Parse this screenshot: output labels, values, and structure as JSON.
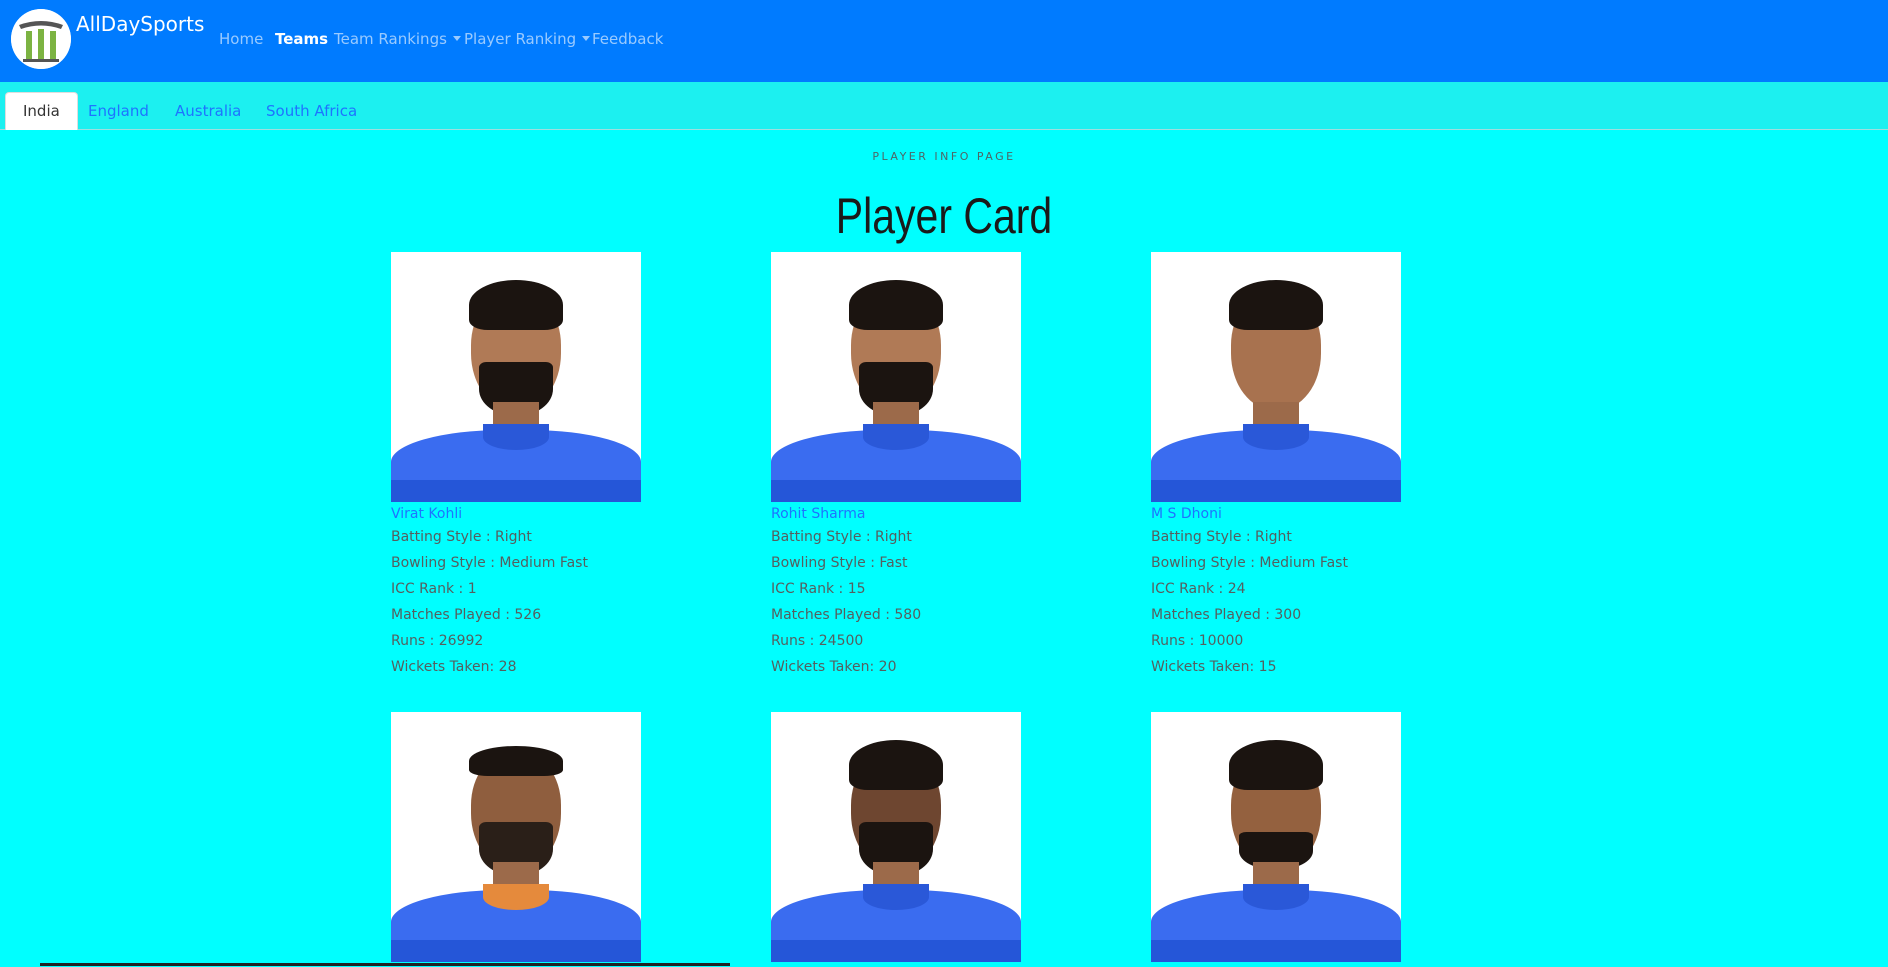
{
  "navbar": {
    "brand": "AllDaySports",
    "links": [
      {
        "label": "Home"
      },
      {
        "label": "Teams",
        "active": true
      },
      {
        "label": "Team Rankings",
        "dropdown": true
      },
      {
        "label": "Player Ranking",
        "dropdown": true
      },
      {
        "label": "Feedback"
      }
    ]
  },
  "tabs": [
    {
      "label": "India",
      "active": true
    },
    {
      "label": "England"
    },
    {
      "label": "Australia"
    },
    {
      "label": "South Africa"
    }
  ],
  "eyebrow": "PLAYER INFO PAGE",
  "title": "Player Card",
  "labels": {
    "batting": "Batting Style : ",
    "bowling": "Bowling Style : ",
    "rank": "ICC Rank : ",
    "matches": "Matches Played : ",
    "runs": "Runs : ",
    "wickets": "Wickets Taken: "
  },
  "players": [
    {
      "name": "Virat Kohli",
      "batting": "Right",
      "bowling": "Medium Fast",
      "rank": "1",
      "matches": "526",
      "runs": "26992",
      "wickets": "28"
    },
    {
      "name": "Rohit Sharma",
      "batting": "Right",
      "bowling": "Fast",
      "rank": "15",
      "matches": "580",
      "runs": "24500",
      "wickets": "20"
    },
    {
      "name": "M S Dhoni",
      "batting": "Right",
      "bowling": "Medium Fast",
      "rank": "24",
      "matches": "300",
      "runs": "10000",
      "wickets": "15"
    }
  ],
  "colors": {
    "navbar": "#007bff",
    "background": "#00ffff",
    "link": "#1e73ff"
  }
}
